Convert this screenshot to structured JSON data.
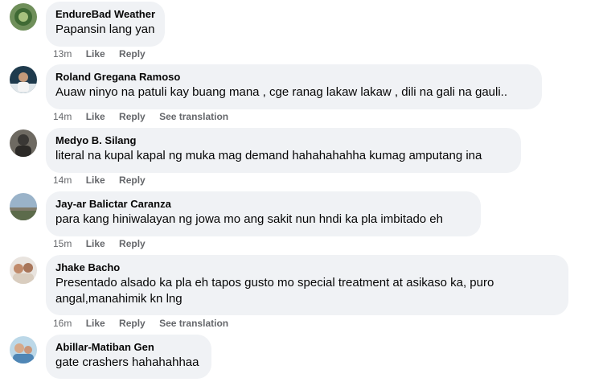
{
  "comments": [
    {
      "author": "EndureBad Weather",
      "text": "Papansin lang yan",
      "time": "13m",
      "like": "Like",
      "reply": "Reply",
      "translation": ""
    },
    {
      "author": "Roland Gregana Ramoso",
      "text": "Auaw ninyo na patuli kay buang mana , cge ranag lakaw lakaw , dili na gali na gauli..",
      "time": "14m",
      "like": "Like",
      "reply": "Reply",
      "translation": "See translation"
    },
    {
      "author": "Medyo B. Silang",
      "text": "literal na kupal kapal ng muka mag demand hahahahahha kumag amputang ina",
      "time": "14m",
      "like": "Like",
      "reply": "Reply",
      "translation": ""
    },
    {
      "author": "Jay-ar Balictar Caranza",
      "text": "para kang hiniwalayan ng jowa mo ang sakit nun hndi ka pla imbitado eh",
      "time": "15m",
      "like": "Like",
      "reply": "Reply",
      "translation": ""
    },
    {
      "author": "Jhake Bacho",
      "text": "Presentado alsado ka pla eh tapos gusto mo special treatment at asikaso ka, puro angal,manahimik kn lng",
      "time": "16m",
      "like": "Like",
      "reply": "Reply",
      "translation": "See translation"
    },
    {
      "author": "Abillar-Matiban Gen",
      "text": "gate crashers hahahahhaa",
      "time": "",
      "like": "",
      "reply": "",
      "translation": ""
    }
  ],
  "colors": {
    "bubble": "#f0f2f5",
    "meta_text": "#65676b",
    "name_text": "#050505"
  }
}
